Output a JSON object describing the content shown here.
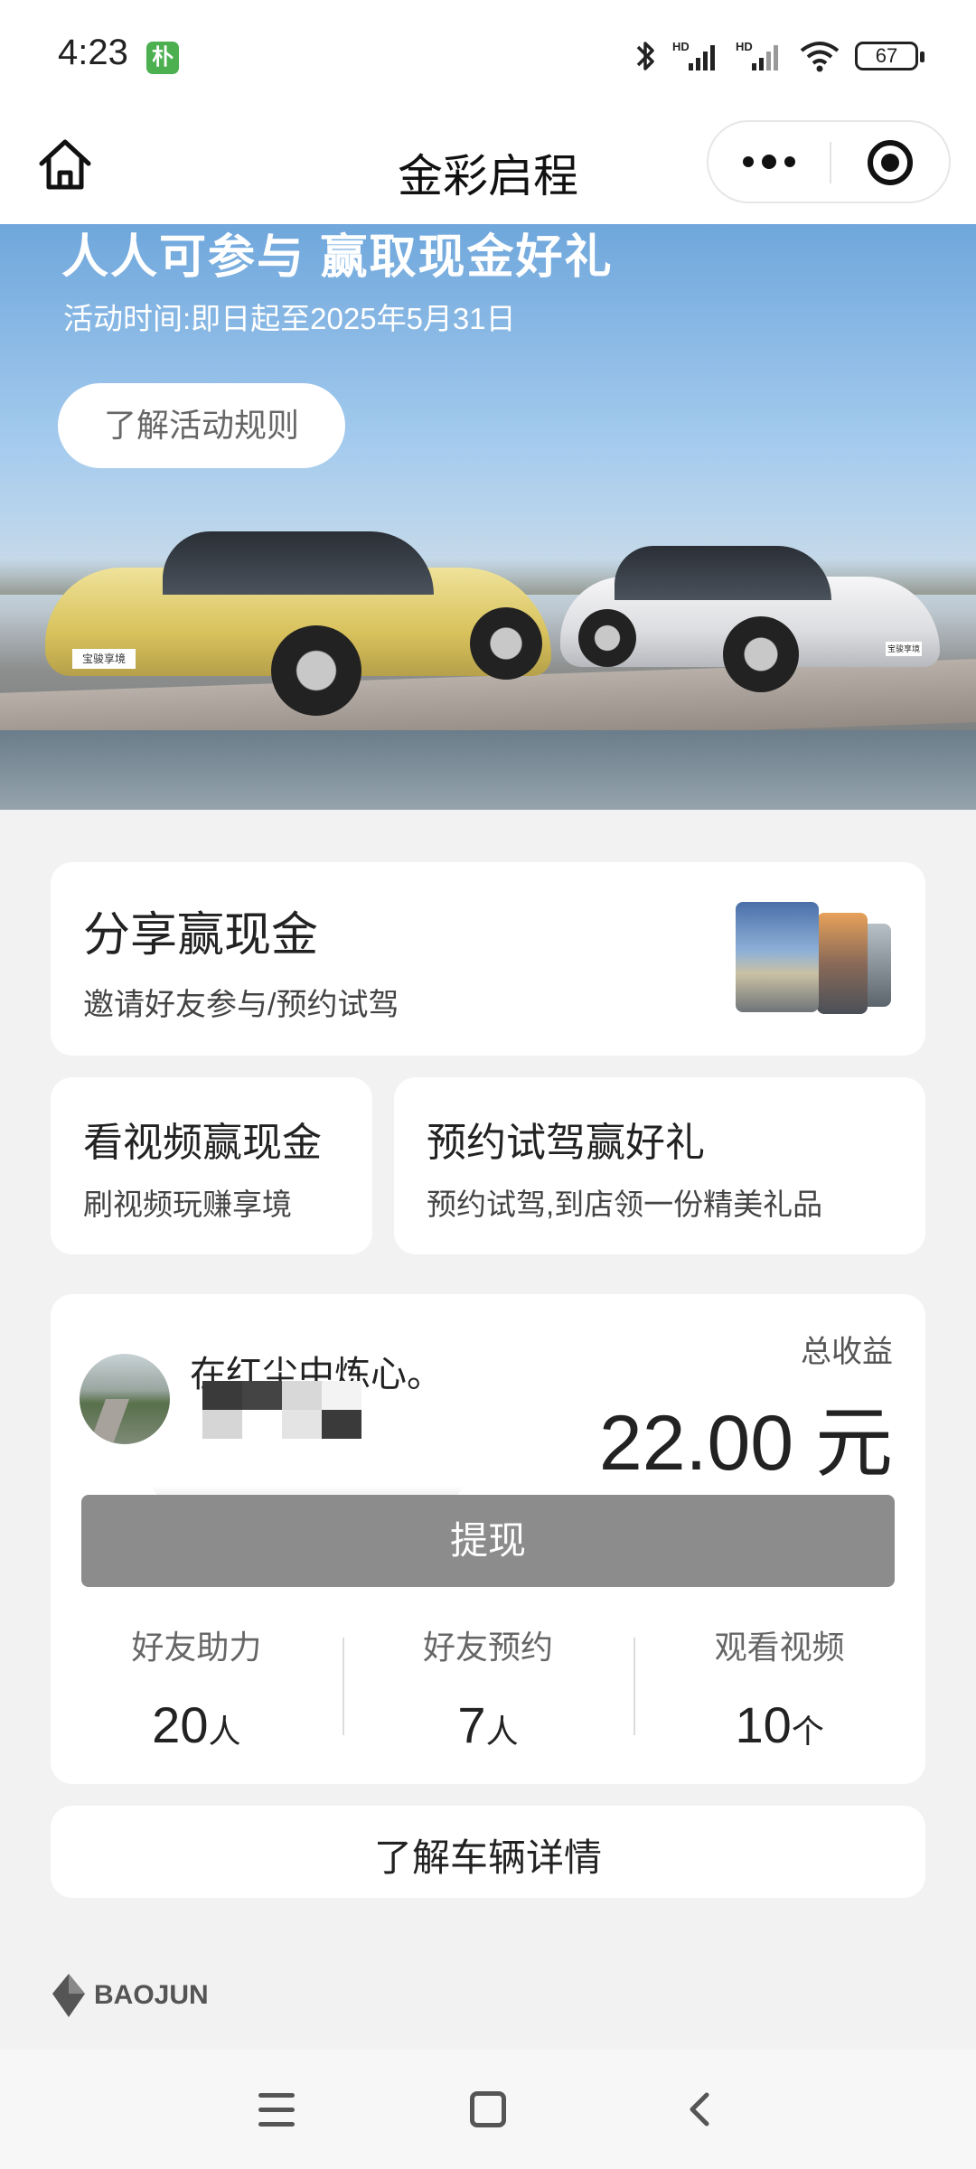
{
  "status_bar": {
    "time": "4:23",
    "app_badge": "朴",
    "battery": "67",
    "icons": [
      "bluetooth-icon",
      "signal-hd-icon",
      "signal-hd-icon",
      "wifi-icon",
      "battery-icon"
    ]
  },
  "nav": {
    "title": "金彩启程",
    "home_icon": "home-icon",
    "more_icon": "more-dots-icon",
    "close_icon": "miniprogram-close-icon"
  },
  "hero": {
    "headline": "人人可参与 赢取现金好礼",
    "period": "活动时间:即日起至2025年5月31日",
    "rules_button": "了解活动规则",
    "car_plate_left": "宝骏享境",
    "car_plate_right": "宝骏享境"
  },
  "share_card": {
    "title": "分享赢现金",
    "subtitle": "邀请好友参与/预约试驾"
  },
  "video_card": {
    "title": "看视频赢现金",
    "subtitle": "刷视频玩赚享境"
  },
  "drive_card": {
    "title": "预约试驾赢好礼",
    "subtitle": "预约试驾,到店领一份精美礼品"
  },
  "earnings": {
    "user_name": "在红尘中炼心。",
    "total_label": "总收益",
    "total_amount": "22.00 元",
    "withdraw_button": "提现",
    "stats": [
      {
        "label": "好友助力",
        "value": "20",
        "unit": "人"
      },
      {
        "label": "好友预约",
        "value": "7",
        "unit": "人"
      },
      {
        "label": "观看视频",
        "value": "10",
        "unit": "个"
      }
    ]
  },
  "details_button": "了解车辆详情",
  "brand": {
    "name": "BAOJUN"
  },
  "colors": {
    "page_bg": "#f2f2f2",
    "card_bg": "#ffffff",
    "withdraw_bg": "#8c8c8c",
    "car_yellow": "#e6d27a",
    "car_white": "#e8e8ea"
  }
}
